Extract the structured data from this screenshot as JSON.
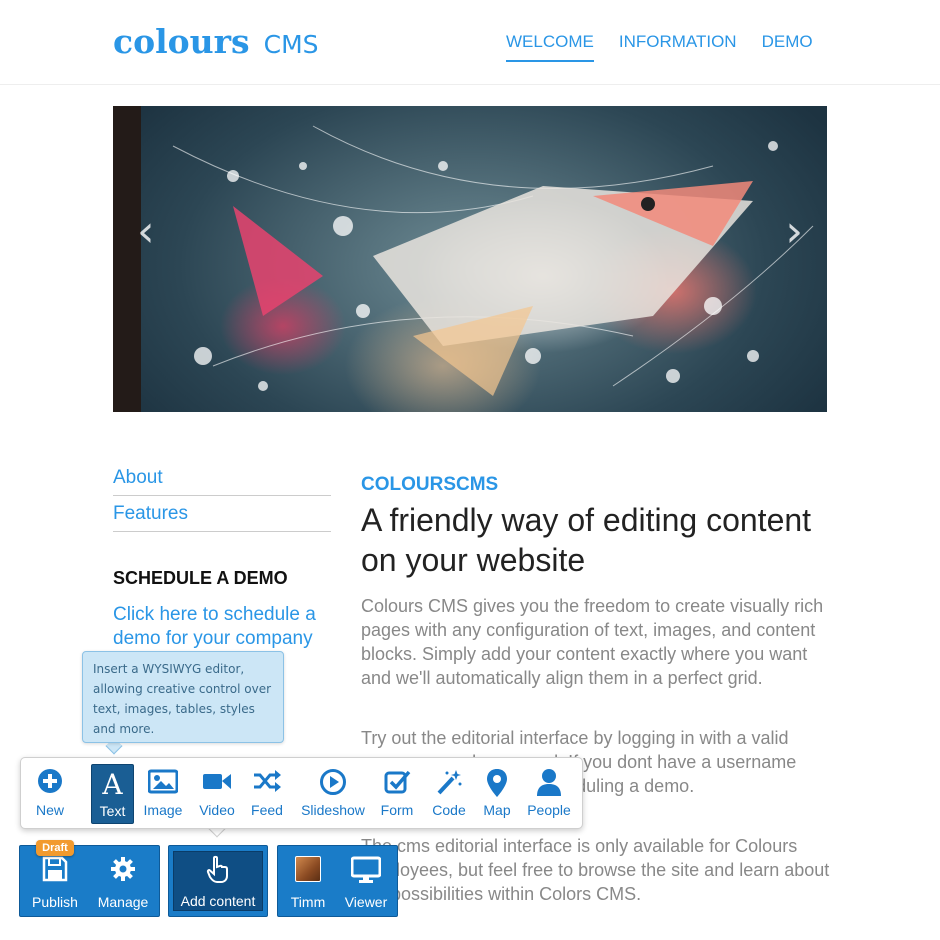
{
  "brand": {
    "name": "colours",
    "suffix": "CMS",
    "color": "#2a96e6"
  },
  "nav": {
    "items": [
      {
        "label": "WELCOME",
        "active": true
      },
      {
        "label": "INFORMATION",
        "active": false
      },
      {
        "label": "DEMO",
        "active": false
      }
    ]
  },
  "hero": {
    "prev_icon": "chevron-left-icon",
    "next_icon": "chevron-right-icon"
  },
  "sidebar": {
    "links": [
      {
        "label": "About"
      },
      {
        "label": "Features"
      }
    ],
    "heading": "SCHEDULE A DEMO",
    "cta": "Click here to schedule a demo for your company"
  },
  "main": {
    "kicker": "COLOURSCMS",
    "headline": "A friendly way of editing content on your website",
    "paragraphs": [
      "Colours CMS gives you the freedom to create visually rich pages with any configuration of text, images, and content blocks. Simply add your content exactly where you want and we'll automatically align them in a perfect grid.",
      "Try out the editorial interface by logging in with a valid username and password. If you dont have a username contact colours.no for scheduling a demo.",
      "The cms editorial interface is only available for Colours employees, but feel free to browse the site and learn about the possibilities within Colors CMS."
    ]
  },
  "tooltip": {
    "text": "Insert a WYSIWYG editor, allowing creative control over text, images, tables, styles and more."
  },
  "toolbar": {
    "items": [
      {
        "label": "New",
        "icon": "plus-circle-icon"
      },
      {
        "label": "Text",
        "icon": "text-icon",
        "active": true
      },
      {
        "label": "Image",
        "icon": "image-icon"
      },
      {
        "label": "Video",
        "icon": "video-camera-icon"
      },
      {
        "label": "Feed",
        "icon": "shuffle-icon"
      },
      {
        "label": "Slideshow",
        "icon": "play-circle-icon"
      },
      {
        "label": "Form",
        "icon": "checkbox-icon"
      },
      {
        "label": "Code",
        "icon": "magic-wand-icon"
      },
      {
        "label": "Map",
        "icon": "map-pin-icon"
      },
      {
        "label": "People",
        "icon": "user-icon"
      }
    ]
  },
  "bottombar": {
    "draft_badge": "Draft",
    "publish": "Publish",
    "manage": "Manage",
    "add_content": "Add content",
    "user": "Timm",
    "viewer": "Viewer"
  }
}
